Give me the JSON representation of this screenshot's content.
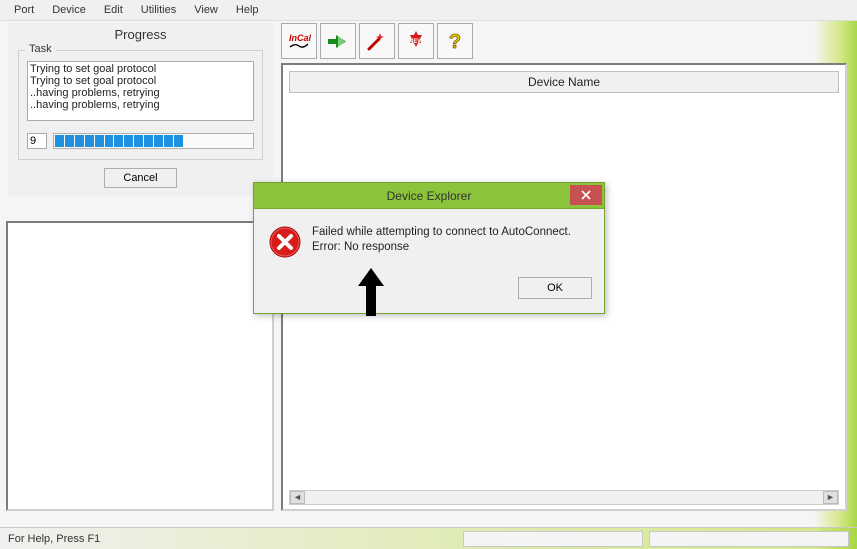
{
  "menu": {
    "items": [
      "Port",
      "Device",
      "Edit",
      "Utilities",
      "View",
      "Help"
    ]
  },
  "progress": {
    "title": "Progress",
    "task_legend": "Task",
    "lines": [
      "Trying to set goal protocol",
      "Trying to set goal protocol",
      "..having problems, retrying",
      "..having problems, retrying"
    ],
    "count": "9",
    "segments_on": 13,
    "segments_total": 20,
    "cancel": "Cancel"
  },
  "toolbar": {
    "icons": [
      "incal-icon",
      "arrow-icon",
      "wand-icon",
      "new-icon",
      "help-icon"
    ]
  },
  "device_panel": {
    "header": "Device Name"
  },
  "dialog": {
    "title": "Device Explorer",
    "msg1": "Failed while attempting to connect to AutoConnect.",
    "msg2": "Error: No response",
    "ok": "OK"
  },
  "statusbar": {
    "text": "For Help, Press F1"
  }
}
